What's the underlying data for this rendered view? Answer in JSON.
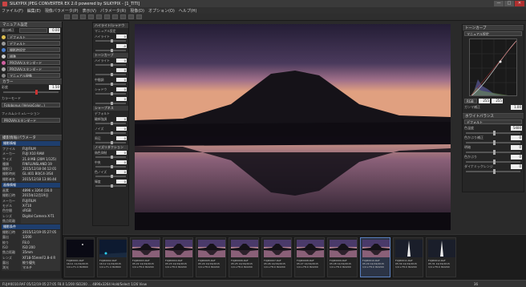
{
  "window": {
    "title": "SILKYPIX JPEG CONVERTER EX 2.0 powered by SILKYPIX - [1_TITI]",
    "min": "—",
    "max": "□",
    "close": "✕"
  },
  "menu": [
    "ファイル(F)",
    "編集(E)",
    "現像パラメータ(P)",
    "表示(V)",
    "パラメータ(R)",
    "現像(D)",
    "オプション(O)",
    "ヘルプ(H)"
  ],
  "left_panel": {
    "header": "マニュアル設定",
    "rows": [
      {
        "label": "露出補正",
        "value": "",
        "num": "0.00"
      },
      {
        "label": "",
        "value": "デフォルト",
        "num": ""
      },
      {
        "label": "",
        "value": "デフォルト",
        "num": ""
      },
      {
        "label": "",
        "value": "撮影時設定",
        "num": ""
      },
      {
        "label": "",
        "value": "標準",
        "num": ""
      },
      {
        "label": "",
        "value": "PROVIA/スタンダード",
        "num": ""
      },
      {
        "label": "",
        "value": "PROVIA/スタンダード",
        "num": ""
      },
      {
        "label": "",
        "value": "マニュアル現像",
        "num": ""
      }
    ],
    "color_header": "カラー",
    "color_value": "0",
    "saturation_label": "彩度",
    "saturation_value": "1.50",
    "color_mode_label": "カラーモード",
    "color_mode_value": "Fotobonus (VelviaColor...)",
    "film_sim_label": "フィルムシミュレーション",
    "film_sim_value": "PROVIA/スタンダード",
    "info_header": "撮影情報/パラメータ",
    "info_sections": [
      {
        "title": "撮影情報",
        "rows": [
          {
            "k": "ファイル",
            "v": "FUJIFILM"
          },
          {
            "k": "メーカー",
            "v": "FUJI X10 RAW"
          },
          {
            "k": "サイズ",
            "v": "21.8 MB (20M 1/125)"
          },
          {
            "k": "種類",
            "v": "FINFLUNSLAND:19"
          },
          {
            "k": "撮影日",
            "v": "2015/12/18 04:12:01"
          },
          {
            "k": "撮影時刻",
            "v": "GL:401 B0(C4-3/S4"
          },
          {
            "k": "撮影者名",
            "v": "2015/12/18 13:06:44"
          }
        ]
      },
      {
        "title": "画像情報",
        "rows": [
          {
            "k": "画素",
            "v": "4896 x 3264 (16.0"
          },
          {
            "k": "撮影日時",
            "v": "2015年12月19日"
          },
          {
            "k": "メーカー",
            "v": "FUJIFILM"
          },
          {
            "k": "モデル",
            "v": "X-T10"
          },
          {
            "k": "色空間",
            "v": "sRGB"
          },
          {
            "k": "レンズ",
            "v": "Digital Camera X-T1"
          },
          {
            "k": "焦点距離",
            "v": ""
          }
        ]
      },
      {
        "title": "撮影条件",
        "rows": [
          {
            "k": "撮影日時",
            "v": "2015/12/19 05:27:05"
          },
          {
            "k": "露出",
            "v": "1/200"
          },
          {
            "k": "絞り",
            "v": "F8.0"
          },
          {
            "k": "ISO",
            "v": "ISO 200"
          },
          {
            "k": "焦点距離",
            "v": "35mm"
          },
          {
            "k": "レンズ",
            "v": "XF18-55mmF2.8-4 R"
          },
          {
            "k": "露出Program",
            "v": "絞り優先"
          },
          {
            "k": "測光",
            "v": "マルチ"
          }
        ]
      }
    ]
  },
  "mid_panel": {
    "sections": [
      {
        "title": "ハイライト/シャドウ",
        "rows": [
          {
            "label": "マニュアル設定",
            "num": ""
          },
          {
            "label": "ハイライト",
            "num": "0"
          },
          {
            "label": "",
            "num": "-0"
          }
        ]
      },
      {
        "title": "トーンカーブ",
        "rows": [
          {
            "label": "ハイライト",
            "num": "0"
          },
          {
            "label": "",
            "num": "0"
          },
          {
            "label": "中間調",
            "num": "0"
          },
          {
            "label": "シャドウ",
            "num": "0"
          },
          {
            "label": "",
            "num": "0"
          }
        ]
      },
      {
        "title": "シャープネス",
        "rows": [
          {
            "label": "デフォルト",
            "num": ""
          },
          {
            "label": "輪郭強調",
            "num": "0"
          },
          {
            "label": "ノイズ",
            "num": "0"
          },
          {
            "label": "周辺",
            "num": "0"
          }
        ]
      },
      {
        "title": "ノイズリダクション",
        "rows": [
          {
            "label": "偽色抑制",
            "num": "0"
          },
          {
            "label": "中央",
            "num": "0"
          },
          {
            "label": "色ノイズ",
            "num": "0"
          },
          {
            "label": "輝度",
            "num": "0"
          }
        ]
      }
    ]
  },
  "right_panel": {
    "header": "トーンカーブ",
    "preset": "マニュアル設定",
    "channel": "RGB",
    "in_value": "255",
    "out_value": "255",
    "gamma_label": "ガンマ補正",
    "gamma_value": "1.00",
    "wb_header": "ホワイトバランス",
    "wb_preset": "デフォルト",
    "sliders": [
      {
        "label": "色温度",
        "num": "5400"
      },
      {
        "label": "色かぶり補正",
        "num": "0"
      },
      {
        "label": "明暗",
        "num": "0"
      },
      {
        "label": "色かぶり",
        "num": "0"
      },
      {
        "label": "ダイナミックレンジ",
        "num": "0"
      }
    ]
  },
  "filmstrip": {
    "thumbs": [
      {
        "cap1": "FUJ#0001.RAF",
        "cap2": "16:11 11/19/2015",
        "cap3": "1/4 s F1.4 ISO800",
        "selected": false,
        "kind": "dark"
      },
      {
        "cap1": "FUJ#0002.RAF",
        "cap2": "16:12 11/19/2015",
        "cap3": "1/4 s F1.4 ISO800",
        "selected": false,
        "kind": "night"
      },
      {
        "cap1": "FUJ#0003.RAF",
        "cap2": "05:22 12/19/2015",
        "cap3": "1/4 s F8.0 ISO200",
        "selected": false,
        "kind": "fuji"
      },
      {
        "cap1": "FUJ#0004.RAF",
        "cap2": "05:23 12/19/2015",
        "cap3": "1/4 s F8.0 ISO200",
        "selected": false,
        "kind": "fuji"
      },
      {
        "cap1": "FUJ#0005.RAF",
        "cap2": "05:24 12/19/2015",
        "cap3": "1/4 s F8.0 ISO200",
        "selected": false,
        "kind": "fuji"
      },
      {
        "cap1": "FUJ#0006.RAF",
        "cap2": "05:25 12/19/2015",
        "cap3": "1/4 s F8.0 ISO200",
        "selected": false,
        "kind": "fuji"
      },
      {
        "cap1": "FUJ#0007.RAF",
        "cap2": "05:26 12/19/2015",
        "cap3": "1/4 s F8.0 ISO200",
        "selected": false,
        "kind": "fuji"
      },
      {
        "cap1": "FUJ#0008.RAF",
        "cap2": "05:27 12/19/2015",
        "cap3": "1/4 s F8.0 ISO200",
        "selected": false,
        "kind": "fuji"
      },
      {
        "cap1": "FUJ#0009.RAF",
        "cap2": "05:28 12/19/2015",
        "cap3": "1/4 s F8.0 ISO200",
        "selected": false,
        "kind": "fuji"
      },
      {
        "cap1": "FUJ#0010.RAF",
        "cap2": "05:29 12/19/2015",
        "cap3": "1/4 s F8.0 ISO200",
        "selected": true,
        "kind": "fuji"
      },
      {
        "cap1": "FUJ#0011.RAF",
        "cap2": "05:30 12/19/2015",
        "cap3": "1/4 s F8.0 ISO200",
        "selected": false,
        "kind": "tower"
      },
      {
        "cap1": "FUJ#0012.RAF",
        "cap2": "05:31 12/19/2015",
        "cap3": "1/4 s F8.0 ISO200",
        "selected": false,
        "kind": "tower"
      }
    ]
  },
  "status": {
    "left": "FUJ#0010.RAF  05/12/19 05:27:05  F8.0 1/200 ISO200 ... 4896x3264  Hold/Select  1/26 View",
    "right": "36"
  },
  "colors": {
    "accent": "#c33333",
    "selected": "#5a7fbf"
  }
}
